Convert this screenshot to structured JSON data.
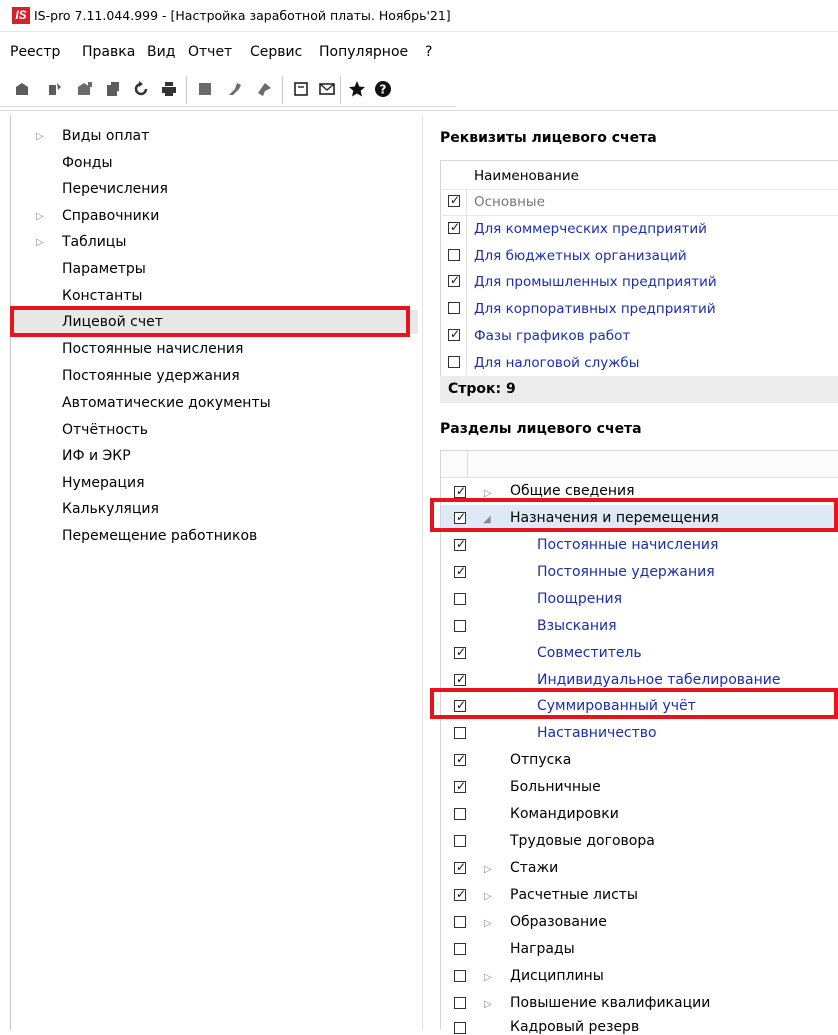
{
  "window": {
    "app_logo": "IS",
    "title": "IS-pro 7.11.044.999 - [Настройка заработной платы. Ноябрь'21]"
  },
  "menu": [
    "Реестр",
    "Правка",
    "Вид",
    "Отчет",
    "Сервис",
    "Популярное",
    "?"
  ],
  "toolbar": {
    "buttons": [
      "create-icon",
      "edit-icon",
      "copy-icon",
      "delete-icon",
      "refresh-icon",
      "print-icon",
      "stop-icon",
      "wrench-icon",
      "arrow-icon",
      "document-icon",
      "mail-icon",
      "star-icon",
      "help-icon"
    ]
  },
  "tree": {
    "selected_index": 7,
    "items": [
      {
        "label": "Виды оплат",
        "expandable": true
      },
      {
        "label": "Фонды",
        "expandable": false
      },
      {
        "label": "Перечисления",
        "expandable": false
      },
      {
        "label": "Справочники",
        "expandable": true
      },
      {
        "label": "Таблицы",
        "expandable": true
      },
      {
        "label": "Параметры",
        "expandable": false
      },
      {
        "label": "Константы",
        "expandable": false
      },
      {
        "label": "Лицевой счет",
        "expandable": false
      },
      {
        "label": "Постоянные начисления",
        "expandable": false
      },
      {
        "label": "Постоянные удержания",
        "expandable": false
      },
      {
        "label": "Автоматические документы",
        "expandable": false
      },
      {
        "label": "Отчётность",
        "expandable": false
      },
      {
        "label": "ИФ и ЭКР",
        "expandable": false
      },
      {
        "label": "Нумерация",
        "expandable": false
      },
      {
        "label": "Калькуляция",
        "expandable": false
      },
      {
        "label": "Перемещение работников",
        "expandable": false
      }
    ]
  },
  "requisites": {
    "title": "Реквизиты лицевого счета",
    "column_header": "Наименование",
    "rows": [
      {
        "label": "Основные",
        "checked": true
      },
      {
        "label": "Для коммерческих предприятий",
        "checked": true
      },
      {
        "label": "Для бюджетных организаций",
        "checked": false
      },
      {
        "label": "Для промышленных предприятий",
        "checked": true
      },
      {
        "label": "Для корпоративных предприятий",
        "checked": false
      },
      {
        "label": "Фазы графиков работ",
        "checked": true
      },
      {
        "label": "Для налоговой службы",
        "checked": false
      }
    ],
    "rows_count": "Строк: 9"
  },
  "sections": {
    "title": "Разделы лицевого счета",
    "rows": [
      {
        "label": "Общие сведения",
        "checked": true,
        "arrow": "collapsed",
        "level": 0
      },
      {
        "label": "Назначения и перемещения",
        "checked": true,
        "arrow": "expanded",
        "level": 0
      },
      {
        "label": "Постоянные начисления",
        "checked": true,
        "arrow": "",
        "level": 1
      },
      {
        "label": "Постоянные удержания",
        "checked": true,
        "arrow": "",
        "level": 1
      },
      {
        "label": "Поощрения",
        "checked": false,
        "arrow": "",
        "level": 1
      },
      {
        "label": "Взыскания",
        "checked": false,
        "arrow": "",
        "level": 1
      },
      {
        "label": "Совместитель",
        "checked": true,
        "arrow": "",
        "level": 1
      },
      {
        "label": "Индивидуальное табелирование",
        "checked": true,
        "arrow": "",
        "level": 1
      },
      {
        "label": "Суммированный учёт",
        "checked": true,
        "arrow": "",
        "level": 1
      },
      {
        "label": "Наставничество",
        "checked": false,
        "arrow": "",
        "level": 1
      },
      {
        "label": "Отпуска",
        "checked": true,
        "arrow": "",
        "level": 0
      },
      {
        "label": "Больничные",
        "checked": true,
        "arrow": "",
        "level": 0
      },
      {
        "label": "Командировки",
        "checked": false,
        "arrow": "",
        "level": 0
      },
      {
        "label": "Трудовые договора",
        "checked": false,
        "arrow": "",
        "level": 0
      },
      {
        "label": "Стажи",
        "checked": true,
        "arrow": "collapsed",
        "level": 0
      },
      {
        "label": "Расчетные листы",
        "checked": true,
        "arrow": "collapsed",
        "level": 0
      },
      {
        "label": "Образование",
        "checked": false,
        "arrow": "collapsed",
        "level": 0
      },
      {
        "label": "Награды",
        "checked": false,
        "arrow": "",
        "level": 0
      },
      {
        "label": "Дисциплины",
        "checked": false,
        "arrow": "collapsed",
        "level": 0
      },
      {
        "label": "Повышение квалификации",
        "checked": false,
        "arrow": "collapsed",
        "level": 0
      },
      {
        "label": "Кадровый резерв",
        "checked": false,
        "arrow": "",
        "level": 0
      }
    ]
  },
  "colors": {
    "logo_red": "#d6202a",
    "highlight_red": "#e8141b",
    "link_blue": "#1a2fa8",
    "selection_blue": "#dde9f6"
  }
}
